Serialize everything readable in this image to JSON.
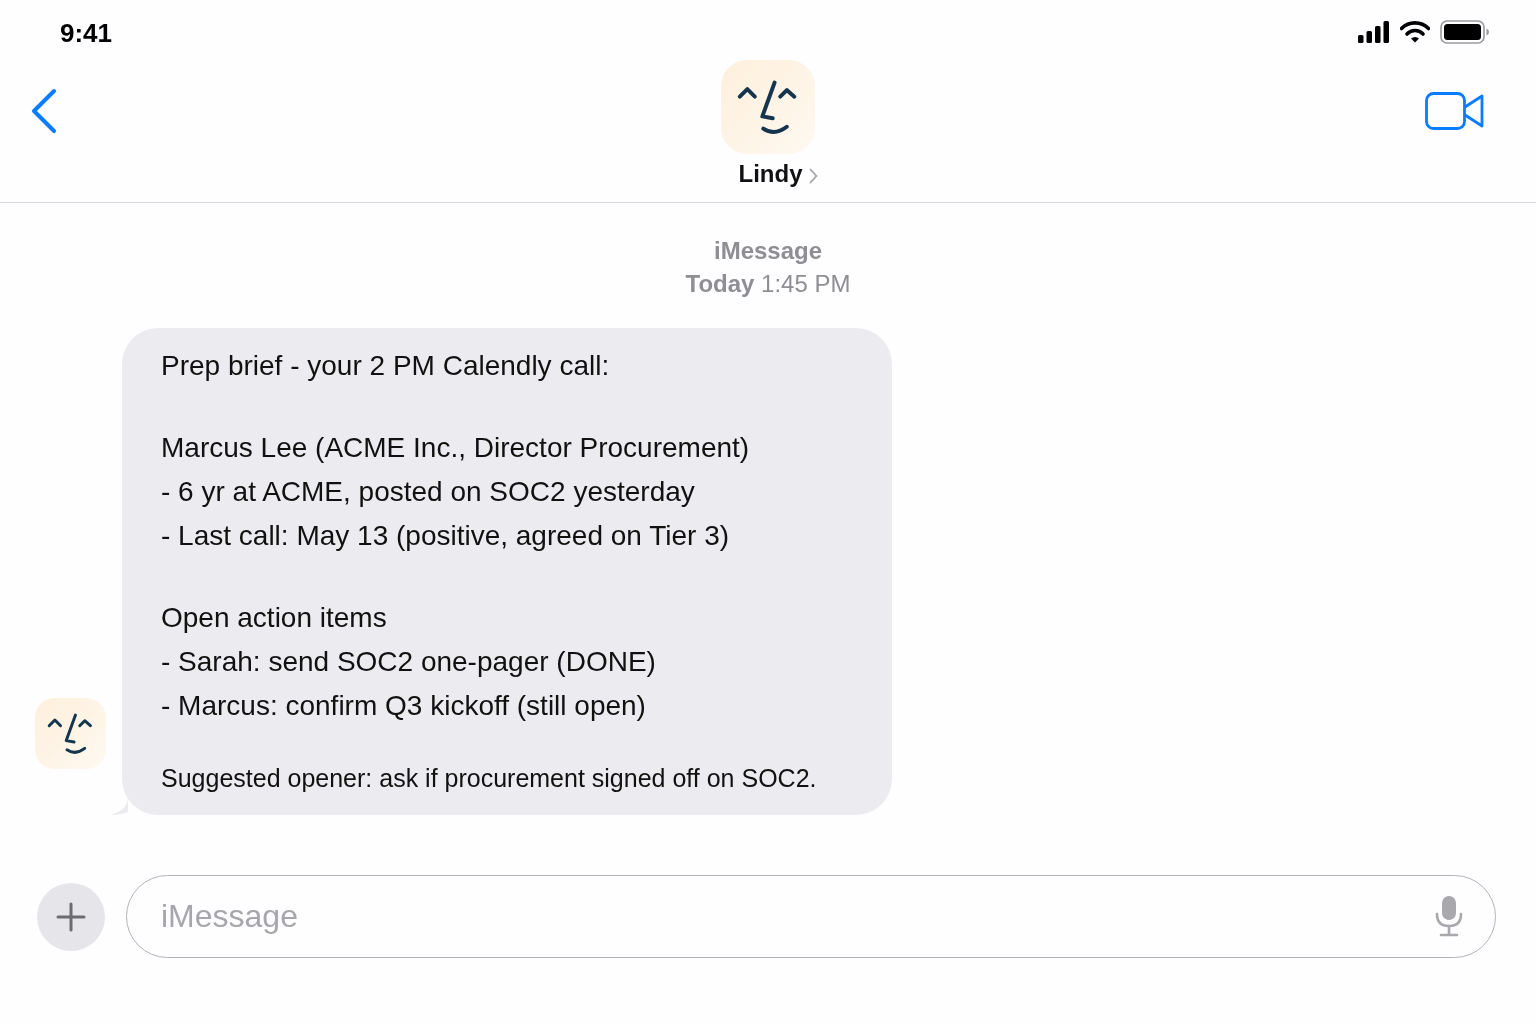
{
  "status_bar": {
    "time": "9:41"
  },
  "header": {
    "contact_name": "Lindy"
  },
  "thread": {
    "service": "iMessage",
    "timestamp": "**Today** 1:45 PM"
  },
  "messages": [
    {
      "blocks": [
        {
          "kind": "body",
          "lines": [
            "Prep brief - your 2 PM Calendly call:"
          ]
        },
        {
          "kind": "body",
          "lines": [
            "Marcus Lee (ACME Inc., Director Procurement)",
            "- 6 yr at ACME, posted on SOC2 yesterday",
            "- Last call: May 13 (positive, agreed on Tier 3)"
          ]
        },
        {
          "kind": "body",
          "lines": [
            "Open action items",
            "- Sarah: send SOC2 one-pager (DONE)",
            "- Marcus: confirm Q3 kickoff (still open)"
          ]
        },
        {
          "kind": "note",
          "lines": [
            "Suggested opener: ask if procurement signed off on SOC2."
          ]
        }
      ]
    }
  ],
  "composer": {
    "placeholder": "iMessage"
  }
}
